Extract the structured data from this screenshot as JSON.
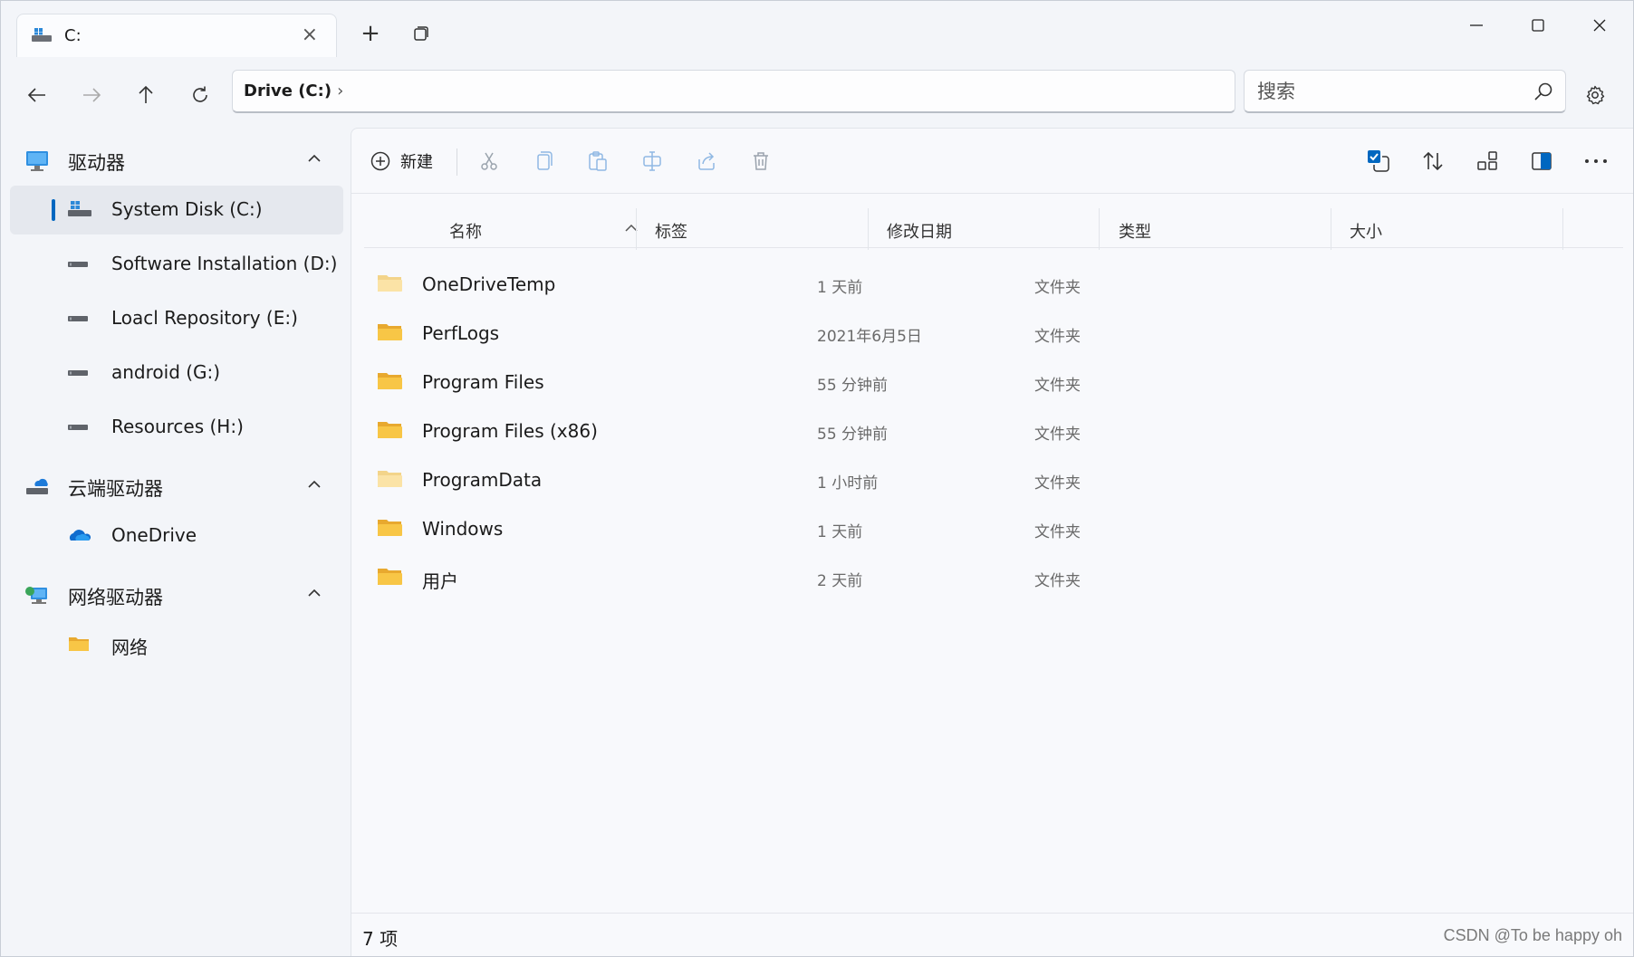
{
  "window": {
    "tab_title": "C:",
    "close_glyph": "×",
    "new_tab_glyph": "+",
    "minimize_glyph": "—",
    "maximize_glyph": "☐",
    "window_close_glyph": "✕"
  },
  "nav": {
    "breadcrumb": "Drive (C:)",
    "breadcrumb_sep": "›",
    "search_placeholder": "搜索"
  },
  "sidebar": {
    "sections": [
      {
        "label": "驱动器",
        "icon": "monitor-icon"
      },
      {
        "label": "云端驱动器",
        "icon": "cloud-drive-icon"
      },
      {
        "label": "网络驱动器",
        "icon": "network-computer-icon"
      }
    ],
    "drives": [
      {
        "label": "System Disk (C:)",
        "icon": "windows-drive-icon",
        "selected": true
      },
      {
        "label": "Software Installation (D:)",
        "icon": "drive-icon"
      },
      {
        "label": "Loacl Repository (E:)",
        "icon": "drive-icon"
      },
      {
        "label": "android (G:)",
        "icon": "drive-icon"
      },
      {
        "label": "Resources (H:)",
        "icon": "drive-icon"
      }
    ],
    "cloud": [
      {
        "label": "OneDrive",
        "icon": "onedrive-icon"
      }
    ],
    "network": [
      {
        "label": "网络",
        "icon": "folder-icon"
      }
    ]
  },
  "toolbar": {
    "new_label": "新建"
  },
  "columns": {
    "name": "名称",
    "tags": "标签",
    "modified": "修改日期",
    "type": "类型",
    "size": "大小"
  },
  "files": [
    {
      "name": "OneDriveTemp",
      "modified": "1 天前",
      "type": "文件夹",
      "faded": true
    },
    {
      "name": "PerfLogs",
      "modified": "2021年6月5日",
      "type": "文件夹",
      "faded": false
    },
    {
      "name": "Program Files",
      "modified": "55 分钟前",
      "type": "文件夹",
      "faded": false
    },
    {
      "name": "Program Files (x86)",
      "modified": "55 分钟前",
      "type": "文件夹",
      "faded": false
    },
    {
      "name": "ProgramData",
      "modified": "1 小时前",
      "type": "文件夹",
      "faded": true
    },
    {
      "name": "Windows",
      "modified": "1 天前",
      "type": "文件夹",
      "faded": false
    },
    {
      "name": "用户",
      "modified": "2 天前",
      "type": "文件夹",
      "faded": false
    }
  ],
  "status": {
    "item_count": "7 项"
  },
  "watermark": "CSDN @To be happy oh",
  "colors": {
    "accent": "#0067c0",
    "folder": "#f8c646",
    "folder_faded": "#fbe3a6"
  }
}
